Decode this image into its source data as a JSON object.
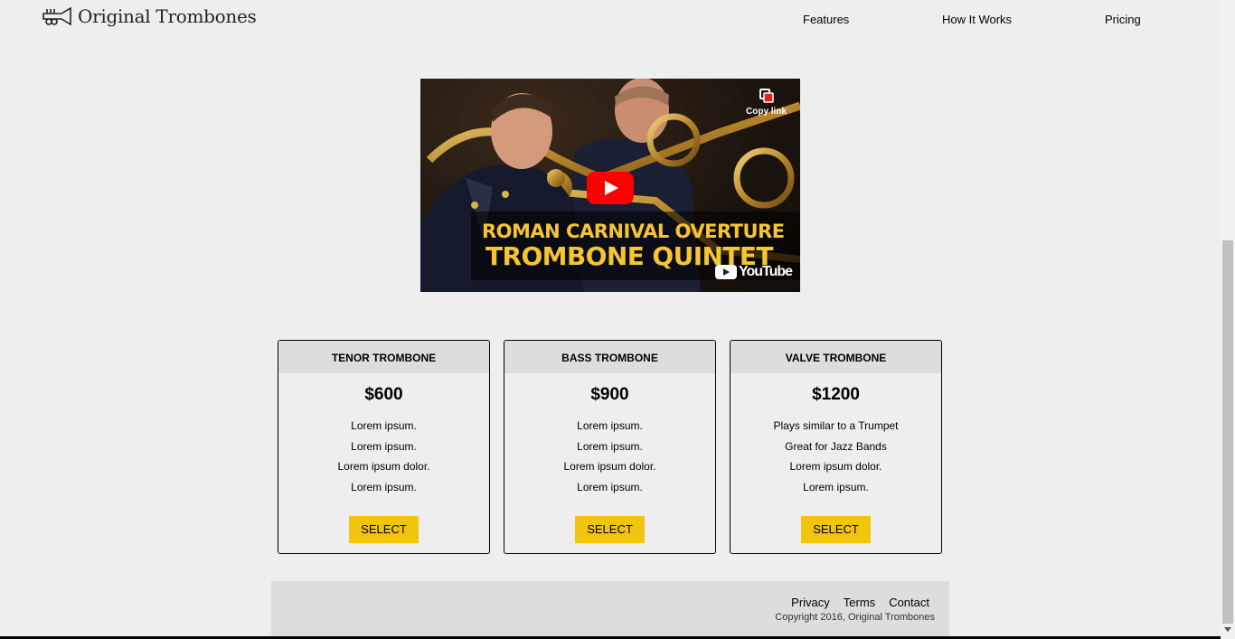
{
  "header": {
    "brand": "Original Trombones",
    "logo_icon": "trumpet-logo-icon",
    "nav": [
      "Features",
      "How It Works",
      "Pricing"
    ]
  },
  "video": {
    "title_line1": "ROMAN CARNIVAL OVERTURE",
    "title_line2": "TROMBONE QUINTET",
    "copy_link_label": "Copy link",
    "platform": "YouTube"
  },
  "pricing": [
    {
      "name": "Tenor Trombone",
      "price": "$600",
      "features": [
        "Lorem ipsum.",
        "Lorem ipsum.",
        "Lorem ipsum dolor.",
        "Lorem ipsum."
      ],
      "button": "SELECT"
    },
    {
      "name": "Bass Trombone",
      "price": "$900",
      "features": [
        "Lorem ipsum.",
        "Lorem ipsum.",
        "Lorem ipsum dolor.",
        "Lorem ipsum."
      ],
      "button": "SELECT"
    },
    {
      "name": "Valve Trombone",
      "price": "$1200",
      "features": [
        "Plays similar to a Trumpet",
        "Great for Jazz Bands",
        "Lorem ipsum dolor.",
        "Lorem ipsum."
      ],
      "button": "SELECT"
    }
  ],
  "footer": {
    "links": [
      "Privacy",
      "Terms",
      "Contact"
    ],
    "copyright": "Copyright 2016, Original Trombones"
  },
  "colors": {
    "background": "#eeeeee",
    "card_header": "#dddddd",
    "select_button": "#f1c40f",
    "video_title": "#f7c533",
    "play_button": "#ff0000"
  }
}
